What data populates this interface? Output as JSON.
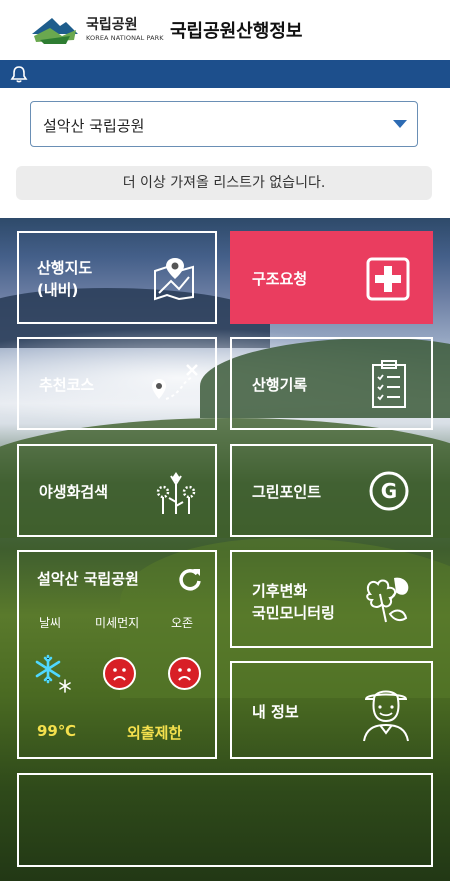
{
  "header": {
    "logo_ko": "국립공원",
    "logo_en": "KOREA NATIONAL PARK",
    "title": "국립공원산행정보"
  },
  "notice": {
    "icon": "bell-icon"
  },
  "park_select": {
    "value": "설악산 국립공원"
  },
  "status_message": "더 이상 가져올 리스트가 없습니다.",
  "menu": {
    "map": {
      "label": "산행지도\n(내비)",
      "icon": "map-pin-icon"
    },
    "rescue": {
      "label": "구조요청",
      "icon": "medical-cross-icon",
      "color": "#ea3d5f"
    },
    "course": {
      "label": "추천코스",
      "icon": "route-icon"
    },
    "record": {
      "label": "산행기록",
      "icon": "clipboard-checklist-icon"
    },
    "flower": {
      "label": "야생화검색",
      "icon": "flowers-icon"
    },
    "green": {
      "label": "그린포인트",
      "icon": "g-circle-icon"
    },
    "climate": {
      "label": "기후변화\n국민모니터링",
      "icon": "leaves-icon"
    },
    "myinfo": {
      "label": "내 정보",
      "icon": "hiker-person-icon"
    }
  },
  "weather": {
    "park": "설악산 국립공원",
    "col_weather": "날씨",
    "col_dust": "미세먼지",
    "col_ozone": "오존",
    "weather_icon": "snowflake-icon",
    "dust_icon": "sad-face-icon",
    "ozone_icon": "sad-face-icon",
    "temperature": "99℃",
    "status": "외출제한",
    "status_color": "#f4e04d"
  }
}
